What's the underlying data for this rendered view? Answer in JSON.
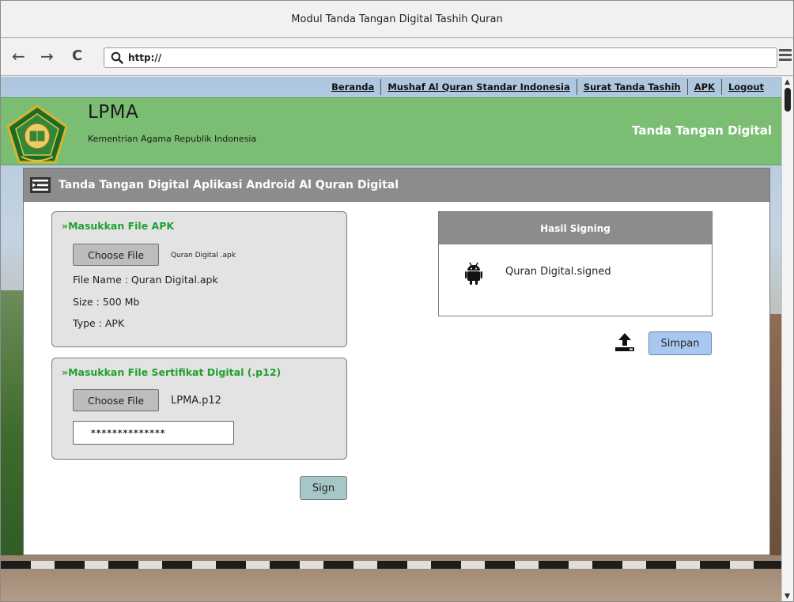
{
  "browser": {
    "window_title": "Modul Tanda Tangan Digital Tashih Quran",
    "url": "http://",
    "back_glyph": "←",
    "forward_glyph": "→",
    "reload_glyph": "C"
  },
  "topnav": {
    "items": [
      "Beranda",
      "Mushaf Al Quran Standar Indonesia",
      "Surat Tanda Tashih",
      "APK",
      "Logout"
    ]
  },
  "header": {
    "brand": "LPMA",
    "subtitle": "Kementrian Agama Republik Indonesia",
    "right_title": "Tanda Tangan Digital"
  },
  "panel": {
    "title": "Tanda Tangan Digital Aplikasi Android Al Quran Digital",
    "apk_box": {
      "title": "»Masukkan File APK",
      "choose_label": "Choose File",
      "selected_file": "Quran Digital .apk",
      "file_name": "File Name : Quran Digital.apk",
      "size": "Size : 500 Mb",
      "type": "Type : APK"
    },
    "cert_box": {
      "title": "»Masukkan File Sertifikat Digital (.p12)",
      "choose_label": "Choose File",
      "selected_file": "LPMA.p12",
      "password_mask": "**************"
    },
    "sign_label": "Sign",
    "result": {
      "title": "Hasil Signing",
      "file": "Quran Digital.signed"
    },
    "save_label": "Simpan"
  },
  "colors": {
    "header_green": "#7bbd72",
    "title_green": "#1fa12e",
    "panel_gray": "#8c8c8c",
    "sign_button": "#a7c6c8",
    "simpan_button": "#a9c8f0"
  },
  "icons": {
    "search": "search-icon",
    "menu": "hamburger-menu-icon",
    "list": "list-icon",
    "android": "android-icon",
    "upload": "upload-icon",
    "logo": "kemenag-logo"
  }
}
